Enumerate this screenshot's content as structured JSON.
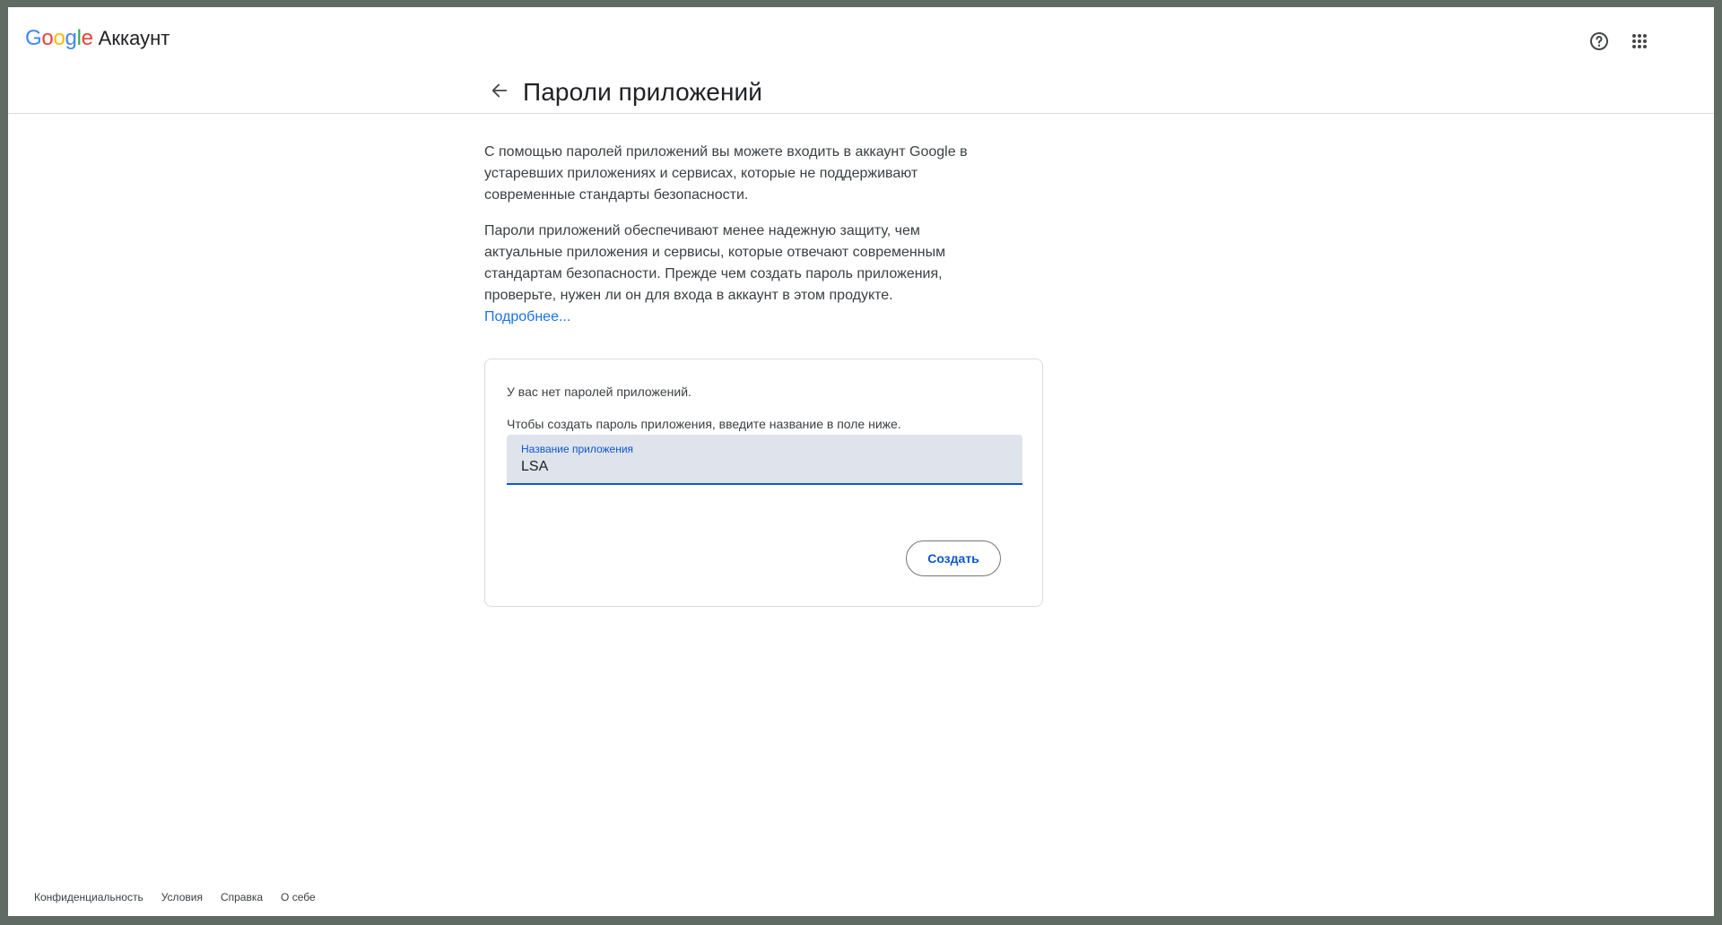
{
  "header": {
    "logo_letters": [
      {
        "ch": "G",
        "color": "#4285F4"
      },
      {
        "ch": "o",
        "color": "#EA4335"
      },
      {
        "ch": "o",
        "color": "#FBBC05"
      },
      {
        "ch": "g",
        "color": "#4285F4"
      },
      {
        "ch": "l",
        "color": "#34A853"
      },
      {
        "ch": "e",
        "color": "#EA4335"
      }
    ],
    "logo_text": "Google",
    "product": "Аккаунт",
    "help_icon": "help-circle-icon",
    "apps_icon": "apps-grid-icon"
  },
  "page": {
    "title": "Пароли приложений",
    "back_icon": "arrow-back-icon"
  },
  "content": {
    "para1": "С помощью паролей приложений вы можете входить в аккаунт Google в устаревших приложениях и сервисах, которые не поддерживают современные стандарты безопасности.",
    "para2": "Пароли приложений обеспечивают менее надежную защиту, чем актуальные приложения и сервисы, которые отвечают современным стандартам безопасности. Прежде чем создать пароль приложения, проверьте, нужен ли он для входа в аккаунт в этом продукте.",
    "learn_more": "Подробнее..."
  },
  "card": {
    "no_passwords": "У вас нет паролей приложений.",
    "instruction": "Чтобы создать пароль приложения, введите название в поле ниже.",
    "field_label": "Название приложения",
    "field_value": "LSA",
    "create_button": "Создать"
  },
  "footer": {
    "links": [
      "Конфиденциальность",
      "Условия",
      "Справка",
      "О себе"
    ]
  },
  "colors": {
    "accent": "#0b57d0",
    "link": "#1a73e8",
    "field_bg": "#dfe3eb"
  }
}
